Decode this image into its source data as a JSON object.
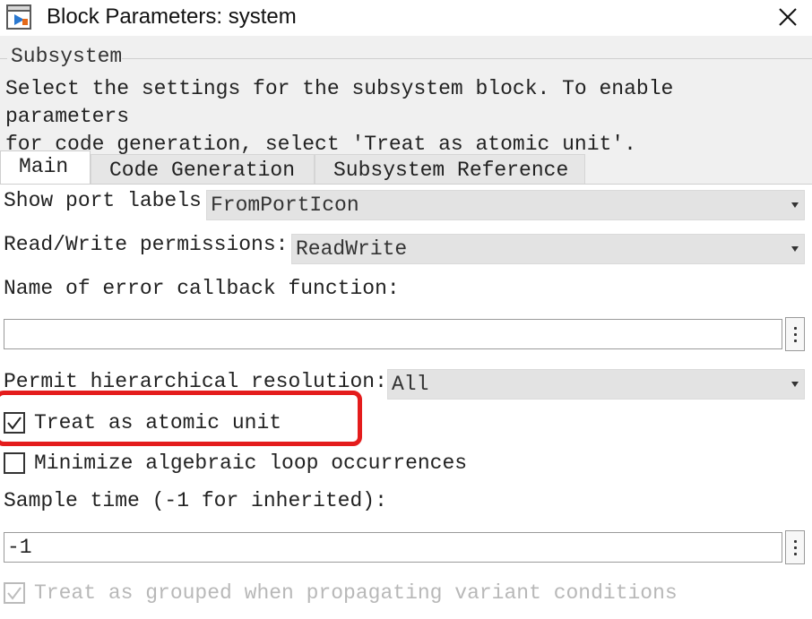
{
  "window": {
    "title": "Block Parameters: system",
    "close_icon": "close-icon",
    "app_icon": "simulink-block-icon"
  },
  "group": {
    "title": "Subsystem",
    "description": "Select the settings for the subsystem block. To enable parameters\nfor code generation, select 'Treat as atomic unit'."
  },
  "tabs": [
    {
      "label": "Main",
      "active": true
    },
    {
      "label": "Code Generation",
      "active": false
    },
    {
      "label": "Subsystem Reference",
      "active": false
    }
  ],
  "main": {
    "show_port_labels": {
      "label": "Show port labels",
      "value": "FromPortIcon"
    },
    "read_write": {
      "label": "Read/Write permissions:",
      "value": "ReadWrite"
    },
    "error_callback": {
      "label": "Name of error callback function:",
      "value": ""
    },
    "hierarchical": {
      "label": "Permit hierarchical resolution:",
      "value": "All"
    },
    "atomic": {
      "label": "Treat as atomic unit",
      "checked": true
    },
    "algebraic": {
      "label": "Minimize algebraic loop occurrences",
      "checked": false
    },
    "sample_time": {
      "label": "Sample time (-1 for inherited):",
      "value": "-1"
    },
    "grouped": {
      "label": "Treat as grouped when propagating variant conditions",
      "checked": true,
      "enabled": false
    }
  },
  "colors": {
    "highlight": "#e41c1c",
    "panel_bg": "#ffffff",
    "dialog_bg": "#f0f0f0"
  }
}
